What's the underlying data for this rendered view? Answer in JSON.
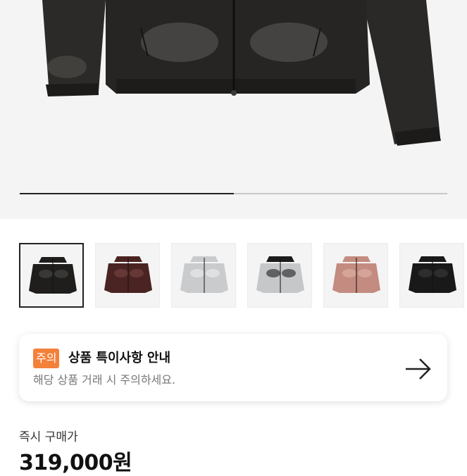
{
  "gallery": {
    "progress_fraction": 0.5,
    "thumbnails": [
      {
        "color": "jacket-black-glossy",
        "selected": true
      },
      {
        "color": "jacket-burgundy",
        "selected": false
      },
      {
        "color": "jacket-silver",
        "selected": false
      },
      {
        "color": "jacket-silver-black",
        "selected": false
      },
      {
        "color": "jacket-pink",
        "selected": false
      },
      {
        "color": "jacket-black-matte",
        "selected": false
      }
    ]
  },
  "notice": {
    "badge": "주의",
    "title": "상품 특이사항 안내",
    "subtitle": "해당 상품 거래 시 주의하세요.",
    "arrow_icon": "arrow-right-icon"
  },
  "price": {
    "label": "즉시 구매가",
    "value": "319,000원"
  },
  "colors": {
    "badge": "#f4813a",
    "hero_background": "#f4f4f4"
  }
}
